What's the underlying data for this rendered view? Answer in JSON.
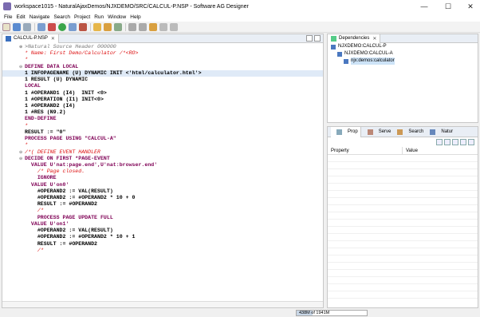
{
  "window": {
    "title": "workspace1015 - NaturalAjaxDemos/NJXDEMO/SRC/CALCUL-P.NSP - Software AG Designer"
  },
  "menu": [
    "File",
    "Edit",
    "Navigate",
    "Search",
    "Project",
    "Run",
    "Window",
    "Help"
  ],
  "editor": {
    "tab_label": "CALCUL-P.NSP",
    "lines": [
      {
        "t": ">Natural Source Header 000000",
        "cls": "cg",
        "fold": "+"
      },
      {
        "t": "* Name: First Demo/Calculator /*<RO>",
        "cls": "c"
      },
      {
        "t": "*",
        "cls": "c"
      },
      {
        "t": "DEFINE DATA LOCAL",
        "cls": "k",
        "fold": "-"
      },
      {
        "t": "1 INFOPAGENAME (U) DYNAMIC INIT <'html/calculator.html'>",
        "cls": "t",
        "hl": true
      },
      {
        "t": "1 RESULT (U) DYNAMIC",
        "cls": "t"
      },
      {
        "t": "LOCAL",
        "cls": "k"
      },
      {
        "t": "1 #OPERAND1 (I4)  INIT <0>",
        "cls": "t"
      },
      {
        "t": "1 #OPERATION (I1) INIT<0>",
        "cls": "t"
      },
      {
        "t": "1 #OPERAND2 (I4)",
        "cls": "t"
      },
      {
        "t": "1 #RES (N9.2)",
        "cls": "t"
      },
      {
        "t": "END-DEFINE",
        "cls": "k"
      },
      {
        "t": "*",
        "cls": "c"
      },
      {
        "t": "RESULT := \"0\"",
        "cls": "t"
      },
      {
        "t": "PROCESS PAGE USING \"CALCUL-A\"",
        "cls": "k"
      },
      {
        "t": "*",
        "cls": "c"
      },
      {
        "t": "/*( DEFINE EVENT HANDLER",
        "cls": "c",
        "fold": "-"
      },
      {
        "t": "DECIDE ON FIRST *PAGE-EVENT",
        "cls": "k",
        "fold": "-"
      },
      {
        "t": "  VALUE U'nat:page.end',U'nat:browser.end'",
        "cls": "k"
      },
      {
        "t": "    /* Page closed.",
        "cls": "c"
      },
      {
        "t": "    IGNORE",
        "cls": "k"
      },
      {
        "t": "  VALUE U'on0'",
        "cls": "k"
      },
      {
        "t": "    #OPERAND2 := VAL(RESULT)",
        "cls": "t"
      },
      {
        "t": "    #OPERAND2 := #OPERAND2 * 10 + 0",
        "cls": "t"
      },
      {
        "t": "    RESULT := #OPERAND2",
        "cls": "t"
      },
      {
        "t": "    /*",
        "cls": "c"
      },
      {
        "t": "    PROCESS PAGE UPDATE FULL",
        "cls": "k"
      },
      {
        "t": "  VALUE U'on1'",
        "cls": "k"
      },
      {
        "t": "    #OPERAND2 := VAL(RESULT)",
        "cls": "t"
      },
      {
        "t": "    #OPERAND2 := #OPERAND2 * 10 + 1",
        "cls": "t"
      },
      {
        "t": "    RESULT := #OPERAND2",
        "cls": "t"
      },
      {
        "t": "    /*",
        "cls": "c"
      }
    ]
  },
  "dependencies": {
    "tab_label": "Dependencies",
    "nodes": [
      {
        "label": "NJXDEMO:CALCUL-P",
        "indent": 0
      },
      {
        "label": "NJXDEMO:CALCUL-A",
        "indent": 1
      },
      {
        "label": "njx:demos:calculator",
        "indent": 2,
        "selected": true
      }
    ]
  },
  "properties": {
    "tabs": [
      "Prop",
      "Serve",
      "Search",
      "Natur"
    ],
    "columns": [
      "Property",
      "Value"
    ]
  },
  "status": {
    "heap": "438M of 1941M",
    "heap_fraction": 0.23
  }
}
